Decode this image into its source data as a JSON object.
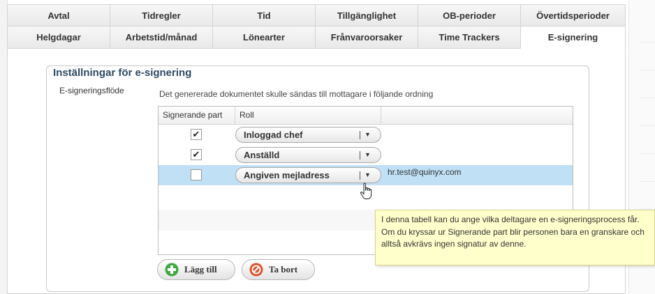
{
  "tabs": {
    "row1": [
      "Avtal",
      "Tidregler",
      "Tid",
      "Tillgänglighet",
      "OB-perioder",
      "Övertidsperioder"
    ],
    "row2": [
      "Helgdagar",
      "Arbetstid/månad",
      "Lönearter",
      "Frånvaroorsaker",
      "Time Trackers",
      "E-signering"
    ],
    "active": "E-signering"
  },
  "section": {
    "title": "Inställningar för e-signering",
    "field_label": "E-signeringsflöde",
    "description": "Det genererade dokumentet skulle sändas till mottagare i följande ordning"
  },
  "grid": {
    "columns": [
      "Signerande part",
      "Roll",
      ""
    ],
    "rows": [
      {
        "checked": true,
        "check_glyph": "✔",
        "role": "Inloggad chef",
        "extra": ""
      },
      {
        "checked": true,
        "check_glyph": "✔",
        "role": "Anställd",
        "extra": ""
      },
      {
        "checked": false,
        "check_glyph": "",
        "role": "Angiven mejladress",
        "extra": "hr.test@quinyx.com"
      }
    ],
    "selected_row": 2
  },
  "buttons": {
    "add": "Lägg till",
    "remove": "Ta bort"
  },
  "tooltip": {
    "text": "I denna tabell kan du ange vilka deltagare en e-signeringsprocess får. Om du kryssar ur Signerande part blir personen bara en granskare och alltså avkrävs ingen signatur av denne."
  },
  "icons": {
    "add": "plus-circle-icon",
    "remove": "no-entry-icon",
    "cursor": "hand-pointer-icon",
    "dropdown": "chevron-down-icon"
  },
  "colors": {
    "selected_row": "#bfe0f5",
    "tooltip_bg": "#ffffcc",
    "title": "#2d4a63",
    "add_icon": "#3faa3f",
    "remove_icon": "#e0522a"
  }
}
